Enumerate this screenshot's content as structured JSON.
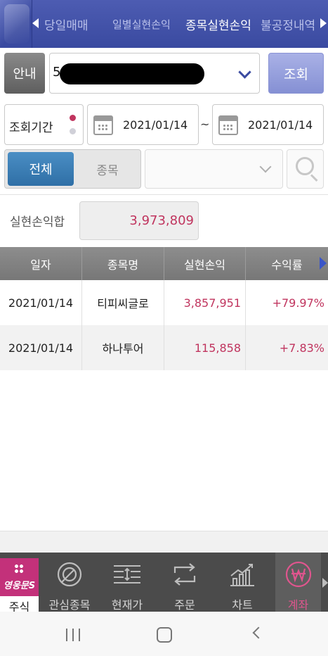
{
  "top_tabs": [
    {
      "label": "당일매매",
      "active": false
    },
    {
      "label": "일별실현손익",
      "active": false
    },
    {
      "label": "종목실현손익",
      "active": true
    },
    {
      "label": "불공정내역",
      "active": false
    }
  ],
  "inquiry": {
    "guide_label": "안내",
    "account_prefix": "5",
    "query_label": "조회",
    "period_label": "조회기간",
    "date_from": "2021/01/14",
    "date_separator": "~",
    "date_to": "2021/01/14",
    "filter_all": "전체",
    "filter_stock": "종목"
  },
  "summary": {
    "label": "실현손익합",
    "value": "3,973,809"
  },
  "table": {
    "headers": [
      "일자",
      "종목명",
      "실현손익",
      "수익률"
    ],
    "rows": [
      {
        "date": "2021/01/14",
        "name": "티피씨글로",
        "pnl": "3,857,951",
        "rate": "+79.97%"
      },
      {
        "date": "2021/01/14",
        "name": "하나투어",
        "pnl": "115,858",
        "rate": "+7.83%"
      }
    ]
  },
  "bottom_nav": {
    "brand_logo": "영웅문S",
    "brand_label": "주식",
    "items": [
      {
        "label": "관심종목",
        "icon": "target-icon"
      },
      {
        "label": "현재가",
        "icon": "price-list-icon"
      },
      {
        "label": "주문",
        "icon": "exchange-icon"
      },
      {
        "label": "차트",
        "icon": "chart-icon"
      },
      {
        "label": "계좌",
        "icon": "won-icon",
        "active": true
      }
    ]
  },
  "colors": {
    "header_blue": "#3a4aa0",
    "accent_red": "#c0345e",
    "active_pink": "#e0558e",
    "segment_blue": "#2f6fa6"
  }
}
